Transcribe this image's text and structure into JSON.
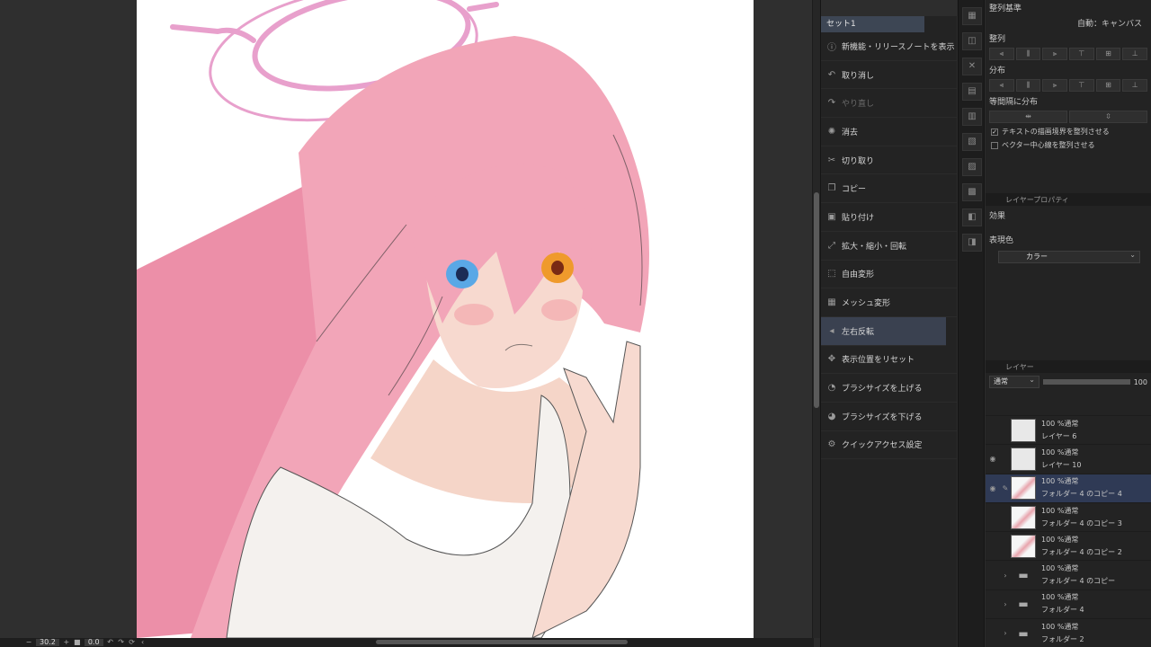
{
  "canvas": {
    "image_desc": "sketch illustration",
    "halo_color": "#e8a0cc",
    "hair_color": "#f2a5b8",
    "skin_color": "#f7d9cf"
  },
  "statusbar": {
    "zoom": "30.2",
    "angle": "0.0"
  },
  "quick_access": {
    "header": "",
    "set_tab": "セット1",
    "items": [
      {
        "label": "新機能・リリースノートを表示",
        "icon": "info-icon",
        "disabled": false
      },
      {
        "label": "取り消し",
        "icon": "undo-icon",
        "disabled": false
      },
      {
        "label": "やり直し",
        "icon": "redo-icon",
        "disabled": true
      },
      {
        "label": "消去",
        "icon": "clear-icon",
        "disabled": false
      },
      {
        "label": "切り取り",
        "icon": "scissors-icon",
        "disabled": false
      },
      {
        "label": "コピー",
        "icon": "copy-icon",
        "disabled": false
      },
      {
        "label": "貼り付け",
        "icon": "paste-icon",
        "disabled": false
      },
      {
        "label": "拡大・縮小・回転",
        "icon": "scale-icon",
        "disabled": false
      },
      {
        "label": "自由変形",
        "icon": "transform-icon",
        "disabled": false
      },
      {
        "label": "メッシュ変形",
        "icon": "mesh-icon",
        "disabled": false
      },
      {
        "label": "左右反転",
        "icon": "flip-icon",
        "disabled": false
      },
      {
        "label": "表示位置をリセット",
        "icon": "reset-view-icon",
        "disabled": false
      },
      {
        "label": "ブラシサイズを上げる",
        "icon": "brush-up-icon",
        "disabled": false
      },
      {
        "label": "ブラシサイズを下げる",
        "icon": "brush-down-icon",
        "disabled": false
      },
      {
        "label": "クイックアクセス設定",
        "icon": "settings-icon",
        "disabled": false
      }
    ]
  },
  "align_panel": {
    "title": "整列基準",
    "mode": "自動：キャンバス",
    "align_label": "整列",
    "distribute_label": "分布",
    "equal_label": "等間隔に分布",
    "check_text_align": "テキストの描画境界を整列させる",
    "check_vector_center": "ベクター中心線を整列させる"
  },
  "layer_property": {
    "tab": "レイヤープロパティ",
    "effect_label": "効果",
    "expression_label": "表現色",
    "expression_value": "カラー"
  },
  "layer_panel": {
    "tab": "レイヤー",
    "blend_mode": "通常",
    "opacity": "100",
    "layers": [
      {
        "opacity": "100 %通常",
        "name": "レイヤー 6",
        "type": "layer",
        "visible": false,
        "selected": false
      },
      {
        "opacity": "100 %通常",
        "name": "レイヤー 10",
        "type": "layer",
        "visible": true,
        "selected": false
      },
      {
        "opacity": "100 %通常",
        "name": "フォルダー 4 のコピー 4",
        "type": "sketch",
        "visible": true,
        "selected": true
      },
      {
        "opacity": "100 %通常",
        "name": "フォルダー 4 のコピー 3",
        "type": "sketch",
        "visible": false,
        "selected": false
      },
      {
        "opacity": "100 %通常",
        "name": "フォルダー 4 のコピー 2",
        "type": "sketch",
        "visible": false,
        "selected": false
      },
      {
        "opacity": "100 %通常",
        "name": "フォルダー 4 のコピー",
        "type": "folder",
        "visible": false,
        "selected": false
      },
      {
        "opacity": "100 %通常",
        "name": "フォルダー 4",
        "type": "folder",
        "visible": false,
        "selected": false
      },
      {
        "opacity": "100 %通常",
        "name": "フォルダー 2",
        "type": "folder",
        "visible": false,
        "selected": false
      }
    ]
  }
}
